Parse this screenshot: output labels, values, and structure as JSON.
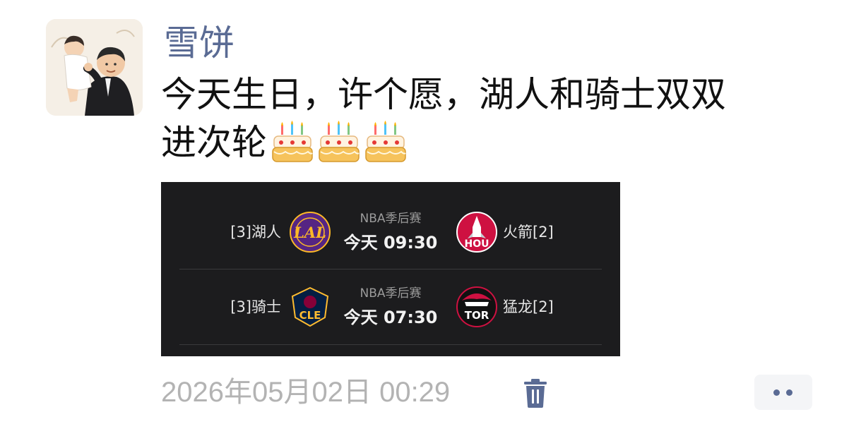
{
  "post": {
    "username": "雪饼",
    "text_line1": "今天生日，许个愿，湖人和骑士双双",
    "text_line2": "进次轮",
    "emoji": "cake-icon",
    "timestamp": "2026年05月02日 00:29"
  },
  "card": {
    "matches": [
      {
        "home_team": "[3]湖人",
        "home_logo_text": "LAL",
        "league": "NBA季后赛",
        "time": "今天 09:30",
        "away_team": "火箭[2]",
        "away_logo_text": "HOU"
      },
      {
        "home_team": "[3]骑士",
        "home_logo_text": "CLE",
        "league": "NBA季后赛",
        "time": "今天 07:30",
        "away_team": "猛龙[2]",
        "away_logo_text": "TOR"
      }
    ]
  },
  "colors": {
    "username": "#5a6b94",
    "card_bg": "#1c1c1e",
    "timestamp": "#b3b3b3"
  }
}
